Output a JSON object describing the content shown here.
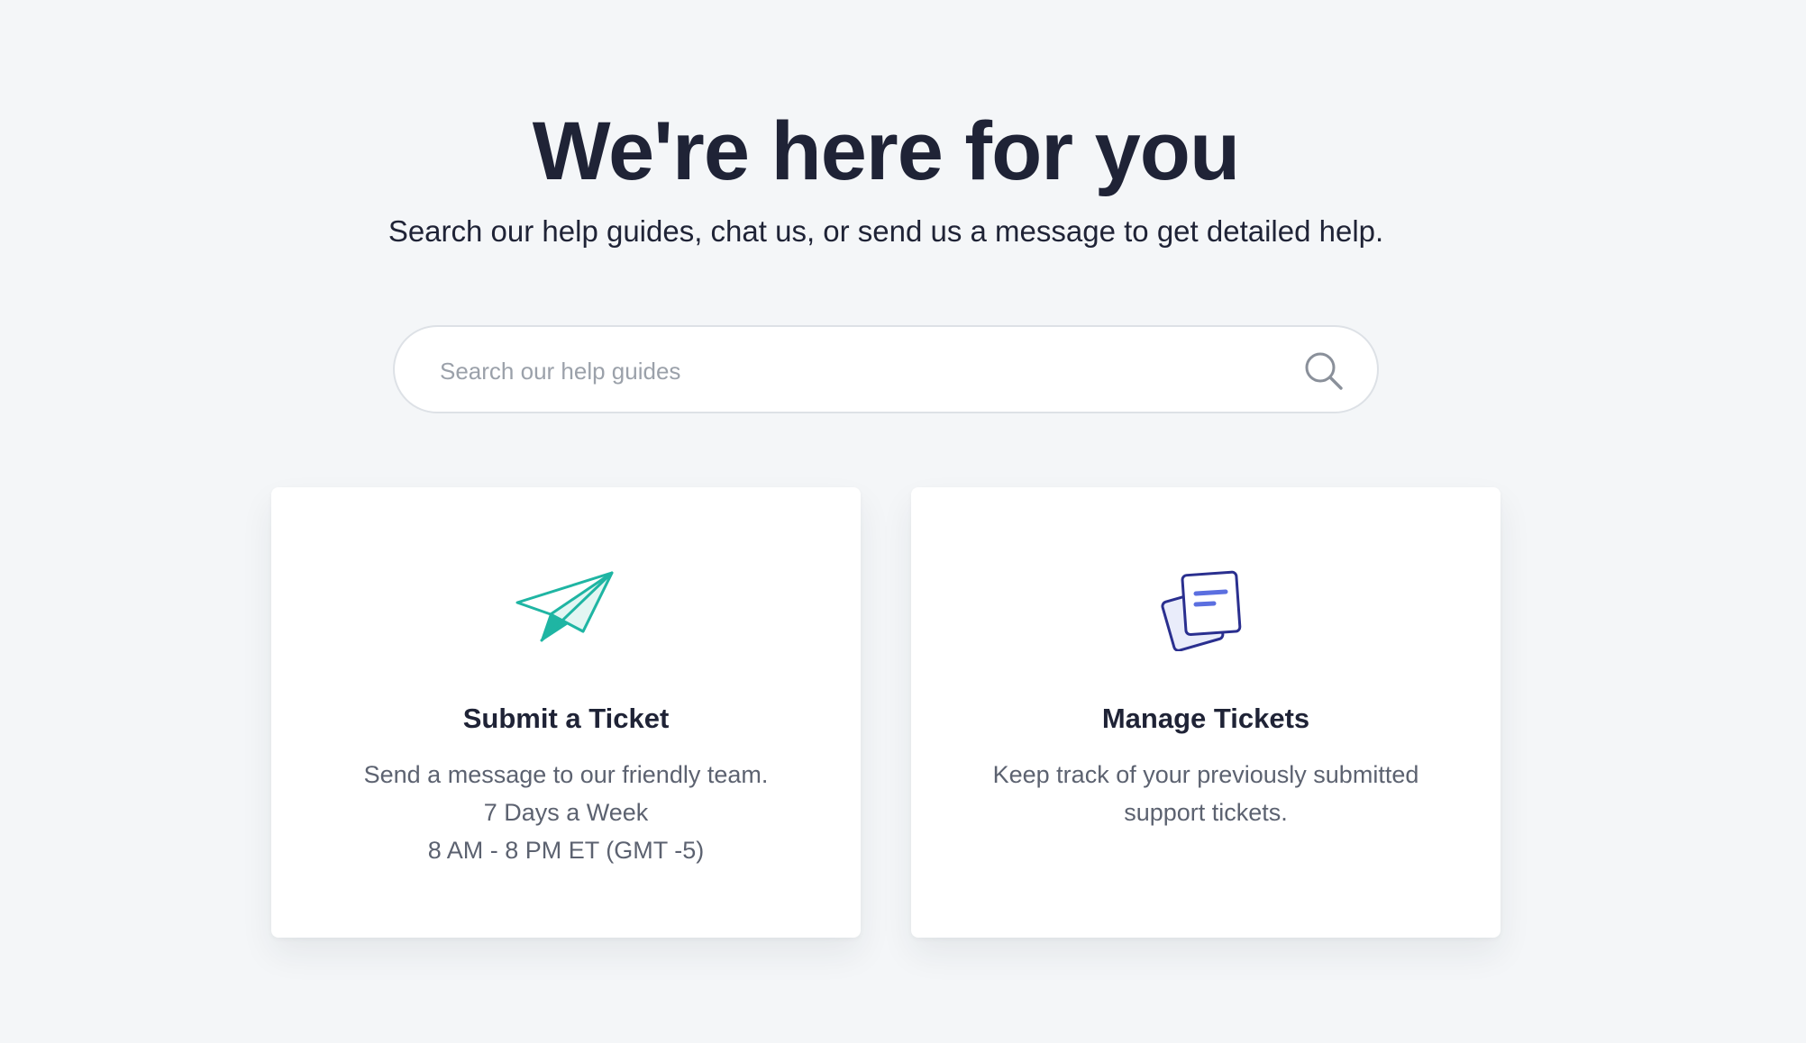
{
  "hero": {
    "title": "We're here for you",
    "subtitle": "Search our help guides, chat us, or send us a message to get detailed help."
  },
  "search": {
    "placeholder": "Search our help guides",
    "value": "",
    "icon": "search-icon"
  },
  "cards": [
    {
      "icon": "paper-plane-icon",
      "title": "Submit a Ticket",
      "lines": [
        "Send a message to our friendly team.",
        "7 Days a Week",
        "8 AM - 8 PM ET (GMT -5)"
      ]
    },
    {
      "icon": "documents-icon",
      "title": "Manage Tickets",
      "lines": [
        "Keep track of your previously submitted",
        "support tickets."
      ]
    }
  ],
  "colors": {
    "background": "#f4f6f8",
    "text_dark": "#1f2336",
    "text_muted": "#5c6270",
    "plane_accent": "#1fb5a3",
    "documents_accent": "#2a2f8f",
    "documents_lines": "#5b6fe0"
  }
}
